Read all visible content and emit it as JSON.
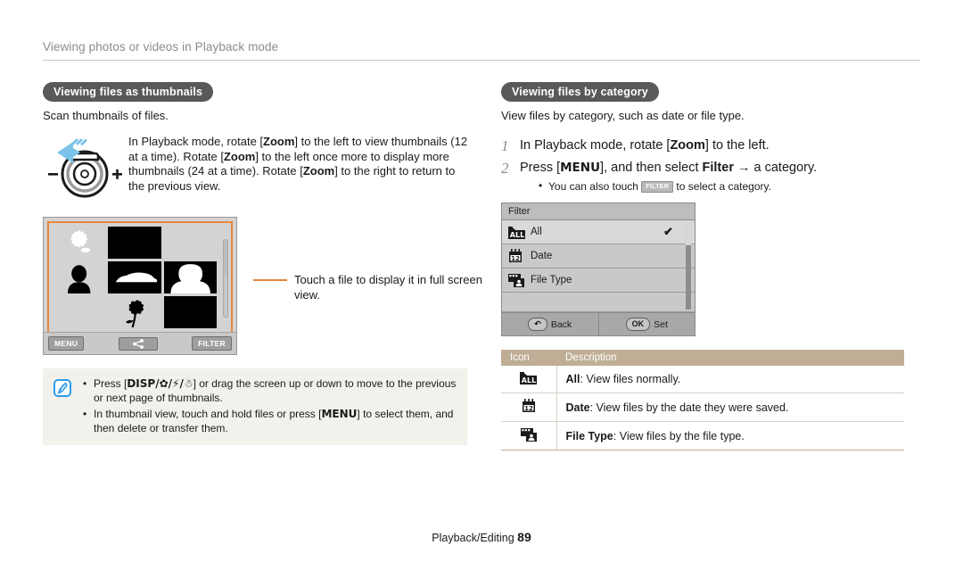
{
  "header": {
    "running_head": "Viewing photos or videos in Playback mode"
  },
  "left": {
    "section_title": "Viewing files as thumbnails",
    "lead": "Scan thumbnails of files.",
    "figure_text_parts": [
      "In Playback mode, rotate [",
      "Zoom",
      "] to the left to view thumbnails (12 at a time). Rotate [",
      "Zoom",
      "] to the left once more to display more thumbnails (24 at a time). Rotate [",
      "Zoom",
      "] to the right to return to the previous view."
    ],
    "lever": {
      "minus_label": "–",
      "plus_label": "+"
    },
    "lcd": {
      "menu_label": "MENU",
      "share_icon": "share-icon",
      "filter_label": "FILTER"
    },
    "callout": "Touch a file to display it in full screen view.",
    "note": {
      "icon": "note-pen-icon",
      "bullets": [
        {
          "pre": "Press [",
          "keys": "DISP/✿/⚡/☃",
          "post": "] or drag the screen up or down to move to the previous or next page of thumbnails."
        },
        {
          "pre": "In thumbnail view, touch and hold files or press [",
          "keys": "MENU",
          "post": "] to select them, and then delete or transfer them."
        }
      ]
    }
  },
  "right": {
    "section_title": "Viewing files by category",
    "lead": "View files by category, such as date or file type.",
    "steps": [
      {
        "num": "1",
        "parts": [
          {
            "t": "In Playback mode, rotate [",
            "b": false
          },
          {
            "t": "Zoom",
            "b": true
          },
          {
            "t": "] to the left.",
            "b": false
          }
        ]
      },
      {
        "num": "2",
        "parts": [
          {
            "t": "Press [",
            "b": false
          },
          {
            "t": "MENU",
            "b": true
          },
          {
            "t": "], and then select ",
            "b": false
          },
          {
            "t": "Filter",
            "b": true
          },
          {
            "t": " → a category.",
            "b": false
          }
        ],
        "sub_pre": "You can also touch ",
        "sub_key": "FILTER",
        "sub_post": " to select a category."
      }
    ],
    "dialog": {
      "title": "Filter",
      "rows": [
        {
          "icon": "filter-all-icon",
          "label": "All",
          "selected": true,
          "check": "✔"
        },
        {
          "icon": "filter-date-icon",
          "label": "Date",
          "selected": false,
          "check": ""
        },
        {
          "icon": "filter-type-icon",
          "label": "File Type",
          "selected": false,
          "check": ""
        }
      ],
      "back_key": "↶",
      "back_label": "Back",
      "ok_key": "OK",
      "ok_label": "Set"
    },
    "table": {
      "headers": [
        "Icon",
        "Description"
      ],
      "rows": [
        {
          "icon": "filter-all-icon",
          "term": "All",
          "desc": ": View files normally."
        },
        {
          "icon": "filter-date-icon",
          "term": "Date",
          "desc": ": View files by the date they were saved."
        },
        {
          "icon": "filter-type-icon",
          "term": "File Type",
          "desc": ": View files by the file type."
        }
      ]
    }
  },
  "footer": {
    "label": "Playback/Editing",
    "page": "89"
  },
  "colors": {
    "accent_orange": "#e8863c",
    "pill_gray": "#59585a",
    "table_header_tan": "#bfae95",
    "note_bg": "#f3f1ec"
  }
}
